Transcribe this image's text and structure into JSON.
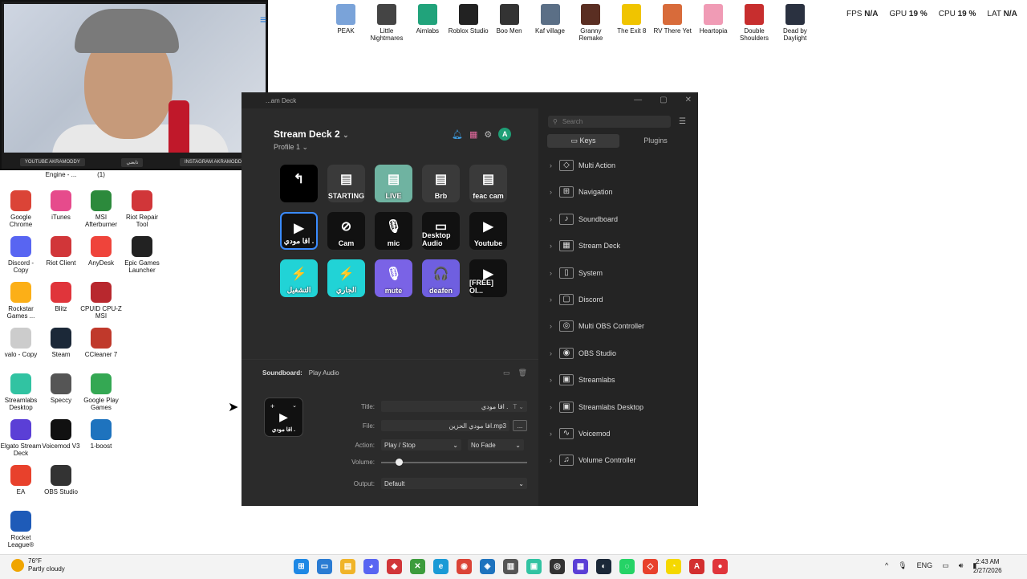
{
  "webcam": {
    "tags": [
      "YOUTUBE AKRAMODDY",
      "تابعني",
      "INSTAGRAM AKRAMODDY"
    ]
  },
  "desktop_icons": [
    {
      "label": "Engine - ...",
      "icon": "engine-icon",
      "color": "#888888"
    },
    {
      "label": "(1)",
      "icon": "file-icon",
      "color": "#888888"
    },
    {
      "label": "Google Chrome",
      "icon": "chrome-icon",
      "color": "#db4437"
    },
    {
      "label": "iTunes",
      "icon": "itunes-icon",
      "color": "#e64b8c"
    },
    {
      "label": "MSI Afterburner",
      "icon": "msi-icon",
      "color": "#2c8a3c"
    },
    {
      "label": "Riot Repair Tool",
      "icon": "riot-repair-icon",
      "color": "#d13639"
    },
    {
      "label": "Discord - Copy",
      "icon": "discord-icon",
      "color": "#5865f2"
    },
    {
      "label": "Riot Client",
      "icon": "riot-icon",
      "color": "#d13639"
    },
    {
      "label": "AnyDesk",
      "icon": "anydesk-icon",
      "color": "#ef443b"
    },
    {
      "label": "Epic Games Launcher",
      "icon": "epic-icon",
      "color": "#222222"
    },
    {
      "label": "Rockstar Games ...",
      "icon": "rockstar-icon",
      "color": "#fcaf17"
    },
    {
      "label": "Blitz",
      "icon": "blitz-icon",
      "color": "#e0353b"
    },
    {
      "label": "CPUID CPU-Z MSI",
      "icon": "cpuz-icon",
      "color": "#b8282e"
    },
    {
      "label": "valo - Copy",
      "icon": "text-file-icon",
      "color": "#cccccc"
    },
    {
      "label": "Steam",
      "icon": "steam-icon",
      "color": "#1b2838"
    },
    {
      "label": "CCleaner 7",
      "icon": "ccleaner-icon",
      "color": "#c0392b"
    },
    {
      "label": "Streamlabs Desktop",
      "icon": "streamlabs-icon",
      "color": "#31c3a2"
    },
    {
      "label": "Speccy",
      "icon": "speccy-icon",
      "color": "#555555"
    },
    {
      "label": "Google Play Games",
      "icon": "play-games-icon",
      "color": "#34a853"
    },
    {
      "label": "Elgato Stream Deck",
      "icon": "stream-deck-icon",
      "color": "#5b3fd6"
    },
    {
      "label": "Voicemod V3",
      "icon": "voicemod-icon",
      "color": "#111111"
    },
    {
      "label": "1-boost",
      "icon": "boost-icon",
      "color": "#1e73be"
    },
    {
      "label": "EA",
      "icon": "ea-icon",
      "color": "#e8412c"
    },
    {
      "label": "OBS Studio",
      "icon": "obs-icon",
      "color": "#333333"
    },
    {
      "label": "Rocket League®",
      "icon": "rocket-league-icon",
      "color": "#1e5bb8"
    }
  ],
  "top_icons": [
    {
      "label": "PEAK",
      "color": "#7aa3d9"
    },
    {
      "label": "Little Nightmares",
      "color": "#444444"
    },
    {
      "label": "Aimlabs",
      "color": "#21a37b"
    },
    {
      "label": "Roblox Studio",
      "color": "#222222"
    },
    {
      "label": "Boo Men",
      "color": "#333333"
    },
    {
      "label": "Kaf village",
      "color": "#5b6f86"
    },
    {
      "label": "Granny Remake",
      "color": "#5a2e22"
    },
    {
      "label": "The Exit 8",
      "color": "#f0c400"
    },
    {
      "label": "RV There Yet",
      "color": "#d86b3a"
    },
    {
      "label": "Heartopia",
      "color": "#f09bb5"
    },
    {
      "label": "Double Shoulders",
      "color": "#c72e2e"
    },
    {
      "label": "Dead by Daylight",
      "color": "#2a3140"
    }
  ],
  "stats": {
    "fps_label": "FPS",
    "fps_value": "N/A",
    "gpu_label": "GPU",
    "gpu_value": "19 %",
    "cpu_label": "CPU",
    "cpu_value": "19 %",
    "lat_label": "LAT",
    "lat_value": "N/A"
  },
  "streamdeck": {
    "window_title": "...am Deck",
    "device": "Stream Deck 2",
    "profile": "Profile 1",
    "keys": [
      {
        "label": "",
        "icon": "↰",
        "bg": "#000000",
        "selected": false
      },
      {
        "label": "STARTING",
        "icon": "▤",
        "bg": "#3a3a3a",
        "selected": false
      },
      {
        "label": "LIVE",
        "icon": "▤",
        "bg": "#6fb3a1",
        "selected": false
      },
      {
        "label": "Brb",
        "icon": "▤",
        "bg": "#3a3a3a",
        "selected": false
      },
      {
        "label": "feac cam",
        "icon": "▤",
        "bg": "#3a3a3a",
        "selected": false
      },
      {
        "label": "اقا مودي .",
        "icon": "▶",
        "bg": "#111111",
        "selected": true
      },
      {
        "label": "Cam",
        "icon": "⊘",
        "bg": "#111111",
        "selected": false
      },
      {
        "label": "mic",
        "icon": "🎙",
        "bg": "#111111",
        "selected": false
      },
      {
        "label": "Desktop Audio",
        "icon": "▭",
        "bg": "#111111",
        "selected": false
      },
      {
        "label": "Youtube",
        "icon": "▶",
        "bg": "#111111",
        "selected": false
      },
      {
        "label": "التشغيل",
        "icon": "⚡",
        "bg": "#21d3d6",
        "selected": false
      },
      {
        "label": "الجاري",
        "icon": "⚡",
        "bg": "#21d3d6",
        "selected": false
      },
      {
        "label": "mute",
        "icon": "🎙",
        "bg": "#7a63e6",
        "selected": false
      },
      {
        "label": "deafen",
        "icon": "🎧",
        "bg": "#6f5fe0",
        "selected": false
      },
      {
        "label": "[FREE] OI...",
        "icon": "▶",
        "bg": "#111111",
        "selected": false
      }
    ],
    "soundboard": {
      "heading": "Soundboard:",
      "action": "Play Audio",
      "preview_label": "اقا مودي .",
      "title_label": "Title:",
      "title_value": "اقا مودي .",
      "file_label": "File:",
      "file_value": "اقا مودي الحزين.mp3",
      "browse_label": "...",
      "action_label": "Action:",
      "action_value": "Play / Stop",
      "fade_value": "No Fade",
      "volume_label": "Volume:",
      "volume_value": 0.1,
      "output_label": "Output:",
      "output_value": "Default"
    },
    "search_placeholder": "Search",
    "tabs": {
      "keys": "Keys",
      "plugins": "Plugins"
    },
    "categories": [
      {
        "label": "Multi Action",
        "icon": "◇"
      },
      {
        "label": "Navigation",
        "icon": "⊞"
      },
      {
        "label": "Soundboard",
        "icon": "♪"
      },
      {
        "label": "Stream Deck",
        "icon": "▦"
      },
      {
        "label": "System",
        "icon": "▯"
      },
      {
        "label": "Discord",
        "icon": "▢"
      },
      {
        "label": "Multi OBS Controller",
        "icon": "◎"
      },
      {
        "label": "OBS Studio",
        "icon": "◉"
      },
      {
        "label": "Streamlabs",
        "icon": "▣"
      },
      {
        "label": "Streamlabs Desktop",
        "icon": "▣"
      },
      {
        "label": "Voicemod",
        "icon": "∿"
      },
      {
        "label": "Volume Controller",
        "icon": "♫"
      }
    ]
  },
  "taskbar": {
    "temp": "76°F",
    "weather": "Partly cloudy",
    "lang": "ENG",
    "time": "2:43 AM",
    "date": "2/27/2026",
    "apps": [
      {
        "name": "start-icon",
        "color": "#1e88e5",
        "glyph": "⊞"
      },
      {
        "name": "widgets-icon",
        "color": "#2b7cd3",
        "glyph": "▭"
      },
      {
        "name": "file-explorer-icon",
        "color": "#f0b429",
        "glyph": "▤"
      },
      {
        "name": "discord-icon",
        "color": "#5865f2",
        "glyph": "◕"
      },
      {
        "name": "riot-icon",
        "color": "#d13639",
        "glyph": "◆"
      },
      {
        "name": "xbox-icon",
        "color": "#3d9c3d",
        "glyph": "✕"
      },
      {
        "name": "edge-icon",
        "color": "#1a9ad6",
        "glyph": "e"
      },
      {
        "name": "chrome-icon",
        "color": "#db4437",
        "glyph": "◉"
      },
      {
        "name": "app-icon",
        "color": "#1e73be",
        "glyph": "◈"
      },
      {
        "name": "store-icon",
        "color": "#555555",
        "glyph": "▥"
      },
      {
        "name": "streamlabs-icon",
        "color": "#31c3a2",
        "glyph": "▣"
      },
      {
        "name": "obs-icon",
        "color": "#333333",
        "glyph": "◎"
      },
      {
        "name": "stream-deck-icon",
        "color": "#5b3fd6",
        "glyph": "▦"
      },
      {
        "name": "steam-icon",
        "color": "#1b2838",
        "glyph": "◐"
      },
      {
        "name": "whatsapp-icon",
        "color": "#25d366",
        "glyph": "◌"
      },
      {
        "name": "valorant-icon",
        "color": "#e8412c",
        "glyph": "◇"
      },
      {
        "name": "snapchat-icon",
        "color": "#f5d800",
        "glyph": "◔"
      },
      {
        "name": "adobe-icon",
        "color": "#d32f2f",
        "glyph": "A"
      },
      {
        "name": "record-icon",
        "color": "#e0353b",
        "glyph": "●"
      }
    ]
  }
}
